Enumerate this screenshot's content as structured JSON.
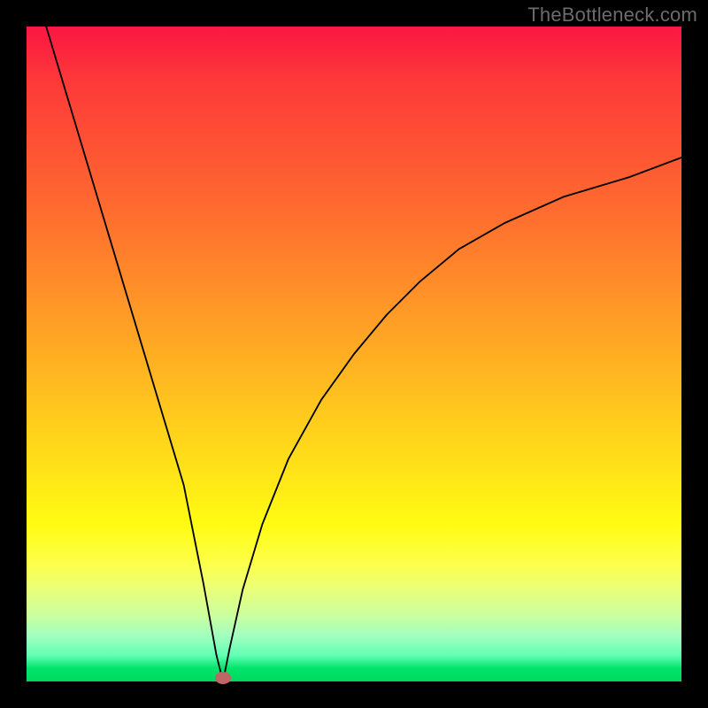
{
  "watermark": "TheBottleneck.com",
  "colors": {
    "frame": "#000000",
    "curve": "#000000",
    "dot": "#c06667",
    "gradient_top": "#fb1643",
    "gradient_mid": "#ffd81a",
    "gradient_bottom": "#00d85f"
  },
  "chart_data": {
    "type": "line",
    "title": "",
    "xlabel": "",
    "ylabel": "",
    "xlim": [
      0,
      100
    ],
    "ylim": [
      0,
      100
    ],
    "grid": false,
    "legend": false,
    "note": "V-shaped bottleneck curve on red→green gradient; minimum near x≈30, y≈0; left branch steep, right branch asymptotic near y≈80",
    "series": [
      {
        "name": "curve-left",
        "x": [
          3,
          6,
          9,
          12,
          15,
          18,
          21,
          24,
          27,
          29,
          30
        ],
        "values": [
          100,
          90,
          80,
          70,
          60,
          50,
          40,
          30,
          15,
          4,
          0
        ]
      },
      {
        "name": "curve-right",
        "x": [
          30,
          31,
          33,
          36,
          40,
          45,
          50,
          55,
          60,
          66,
          73,
          82,
          92,
          100
        ],
        "values": [
          0,
          5,
          14,
          24,
          34,
          43,
          50,
          56,
          61,
          66,
          70,
          74,
          77,
          80
        ]
      }
    ],
    "min_point": {
      "x": 30,
      "y": 0
    }
  }
}
